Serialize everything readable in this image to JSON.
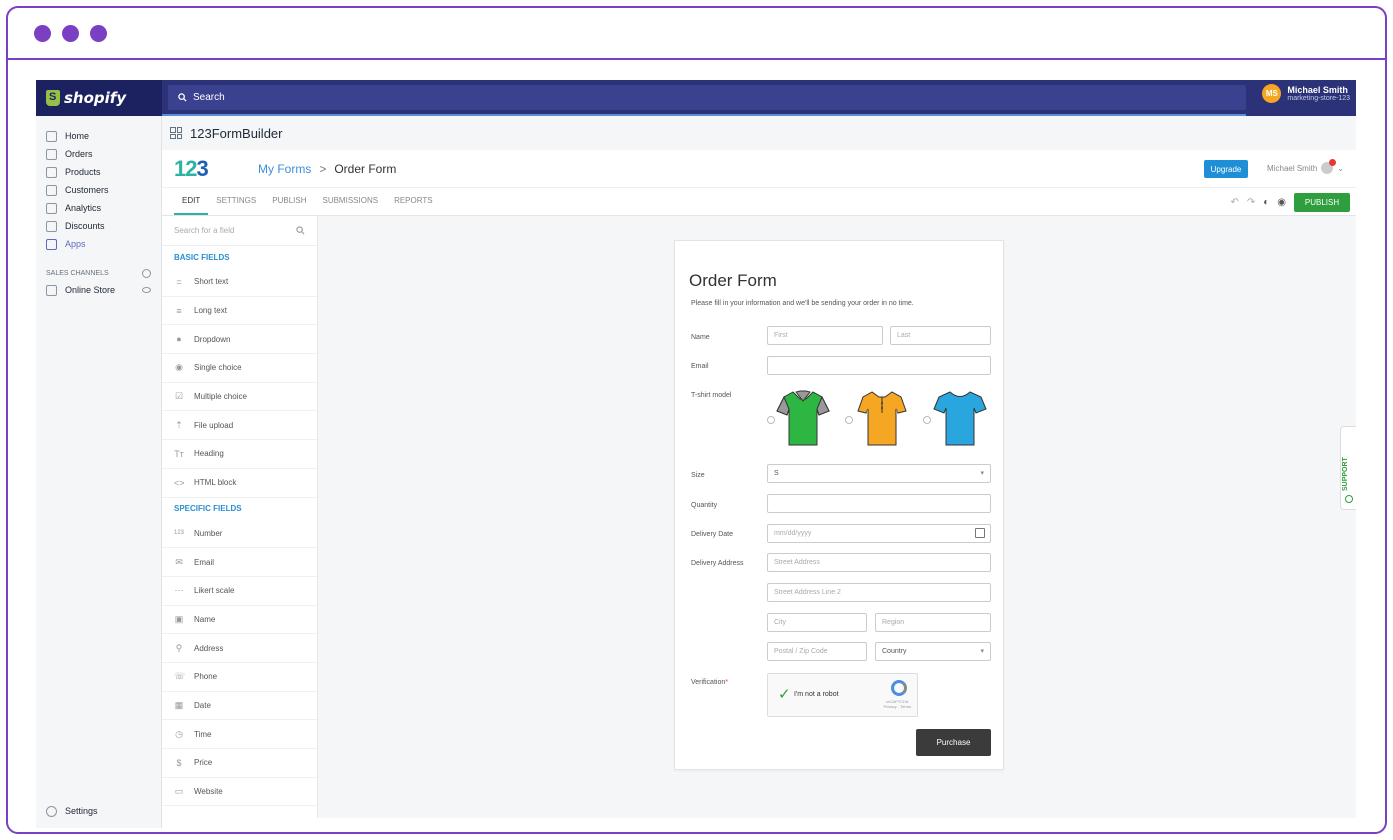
{
  "window": {
    "dots": 3,
    "accent": "#7b3fc4"
  },
  "topbar": {
    "brand": "shopify",
    "search_label": "Search",
    "user": {
      "initials": "MS",
      "name": "Michael Smith",
      "store": "marketing-store-123"
    }
  },
  "sidebar": {
    "items": [
      {
        "label": "Home",
        "icon": "home-icon"
      },
      {
        "label": "Orders",
        "icon": "orders-icon"
      },
      {
        "label": "Products",
        "icon": "tag-icon"
      },
      {
        "label": "Customers",
        "icon": "person-icon"
      },
      {
        "label": "Analytics",
        "icon": "bar-chart-icon"
      },
      {
        "label": "Discounts",
        "icon": "discount-icon"
      },
      {
        "label": "Apps",
        "icon": "apps-icon"
      }
    ],
    "sales_channels_label": "SALES CHANNELS",
    "online_store_label": "Online Store",
    "settings_label": "Settings"
  },
  "app_header": {
    "title": "123FormBuilder"
  },
  "formbuilder": {
    "breadcrumb": {
      "parent": "My Forms",
      "separator": ">",
      "current": "Order Form"
    },
    "upgrade_label": "Upgrade",
    "user_name": "Michael Smith",
    "tabs": [
      "EDIT",
      "SETTINGS",
      "PUBLISH",
      "SUBMISSIONS",
      "REPORTS"
    ],
    "active_tab": "EDIT",
    "publish_label": "PUBLISH"
  },
  "fields_panel": {
    "search_placeholder": "Search for a field",
    "basic_heading": "BASIC FIELDS",
    "basic": [
      {
        "label": "Short text",
        "icon": "="
      },
      {
        "label": "Long text",
        "icon": "≡"
      },
      {
        "label": "Dropdown",
        "icon": "●"
      },
      {
        "label": "Single choice",
        "icon": "◉"
      },
      {
        "label": "Multiple choice",
        "icon": "☑"
      },
      {
        "label": "File upload",
        "icon": "⇡"
      },
      {
        "label": "Heading",
        "icon": "Tт"
      },
      {
        "label": "HTML block",
        "icon": "<>"
      }
    ],
    "specific_heading": "SPECIFIC FIELDS",
    "specific": [
      {
        "label": "Number",
        "icon": "123"
      },
      {
        "label": "Email",
        "icon": "✉"
      },
      {
        "label": "Likert scale",
        "icon": "⋯"
      },
      {
        "label": "Name",
        "icon": "▣"
      },
      {
        "label": "Address",
        "icon": "⚲"
      },
      {
        "label": "Phone",
        "icon": "☏"
      },
      {
        "label": "Date",
        "icon": "▦"
      },
      {
        "label": "Time",
        "icon": "◷"
      },
      {
        "label": "Price",
        "icon": "$"
      },
      {
        "label": "Website",
        "icon": "▭"
      }
    ]
  },
  "form": {
    "title": "Order Form",
    "description": "Please fill in your information and we'll be sending your order in no time.",
    "name_label": "Name",
    "first_placeholder": "First",
    "last_placeholder": "Last",
    "email_label": "Email",
    "tshirt_label": "T-shirt model",
    "shirt_colors": [
      "#2db742",
      "#f5a623",
      "#2aa6df"
    ],
    "size_label": "Size",
    "size_value": "S",
    "quantity_label": "Quantity",
    "delivery_date_label": "Delivery Date",
    "date_placeholder": "mm/dd/yyyy",
    "delivery_address_label": "Delivery Address",
    "street_placeholder": "Street Address",
    "street2_placeholder": "Street Address Line 2",
    "city_placeholder": "City",
    "region_placeholder": "Region",
    "zip_placeholder": "Postal / Zip Code",
    "country_placeholder": "Country",
    "verification_label": "Verification",
    "required_mark": "*",
    "captcha_label": "I'm not a robot",
    "captcha_brand": "reCAPTCHA",
    "captcha_terms": "Privacy - Terms",
    "purchase_label": "Purchase"
  },
  "support_label": "SUPPORT"
}
